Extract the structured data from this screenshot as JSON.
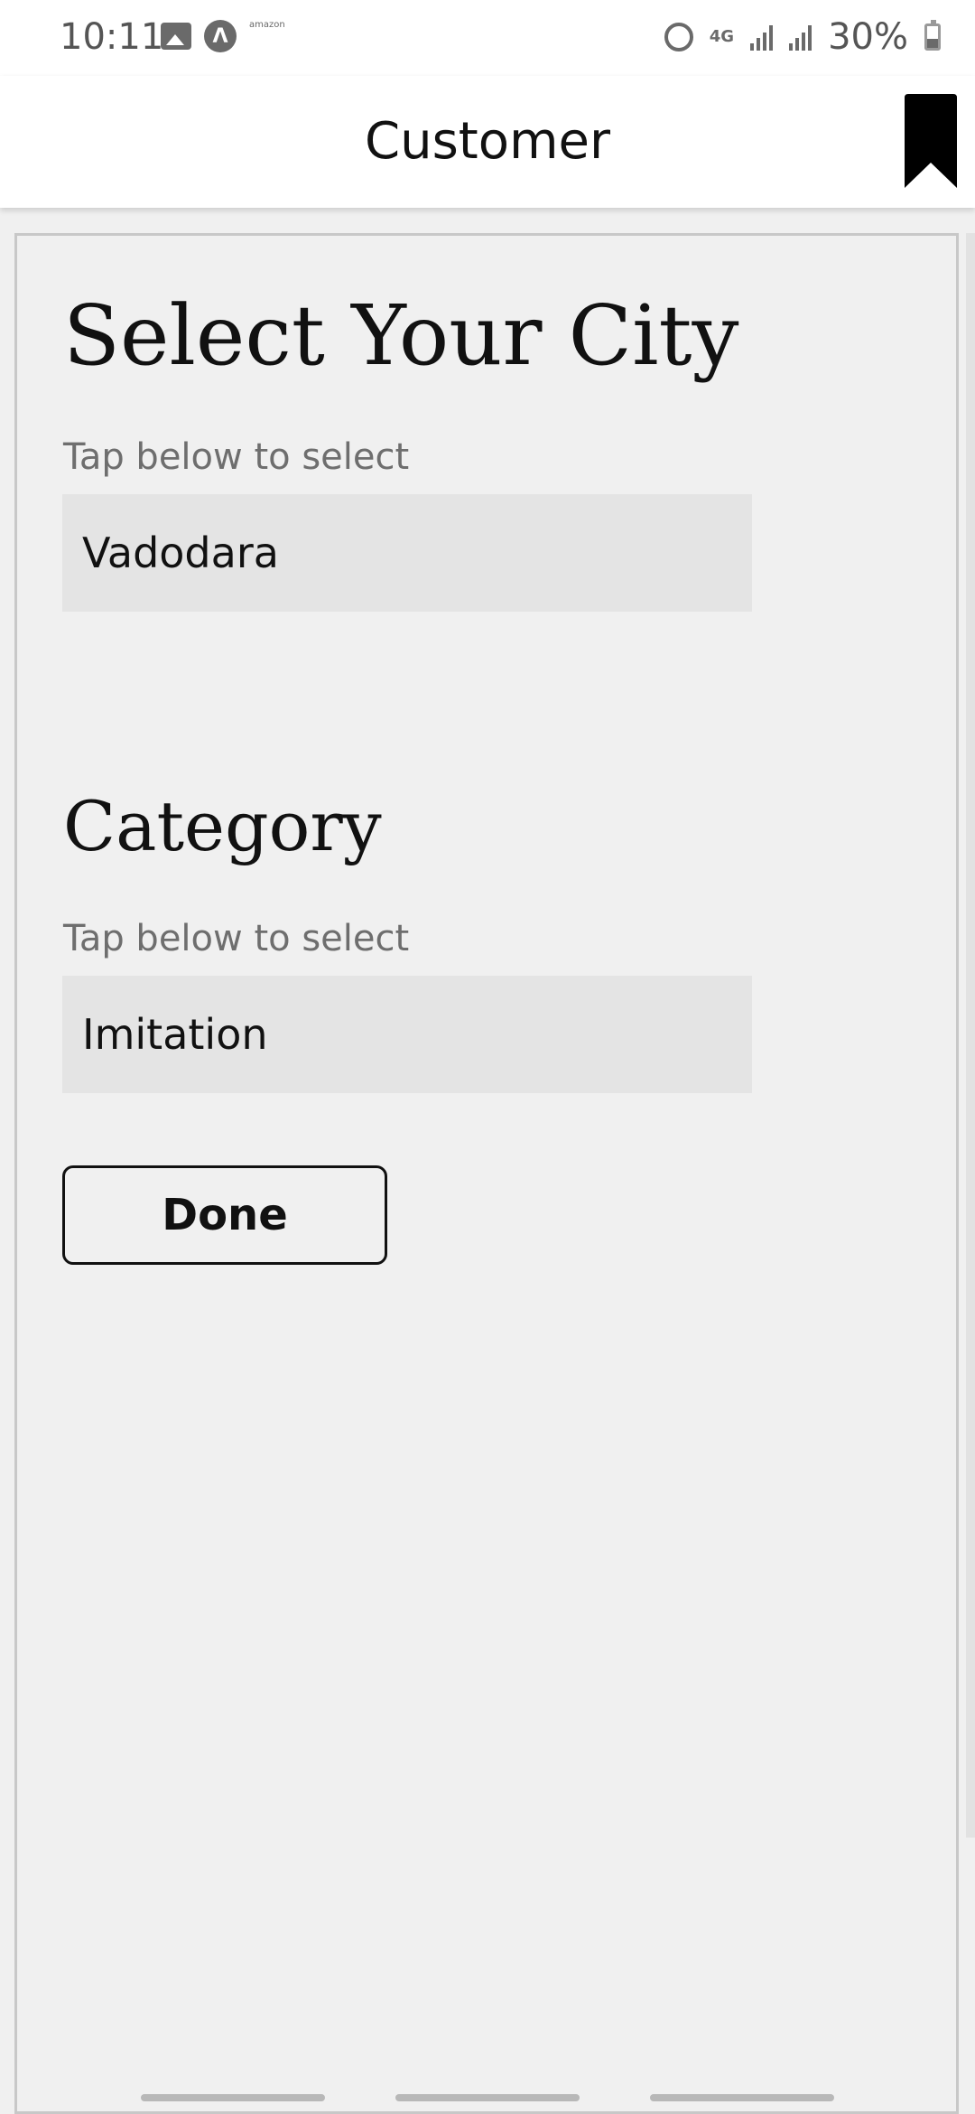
{
  "status_bar": {
    "time": "10:11",
    "amazon_text": "amazon",
    "network": "4G",
    "battery_percent": "30%"
  },
  "appbar": {
    "title": "Customer",
    "bookmark_icon": "bookmark-icon"
  },
  "city_section": {
    "heading": "Select Your City",
    "hint": "Tap below to select",
    "selected_value": "Vadodara"
  },
  "category_section": {
    "heading": "Category",
    "hint": "Tap below to select",
    "selected_value": "Imitation"
  },
  "done_label": "Done",
  "colors": {
    "background": "#f0f0f0",
    "appbar": "#ffffff",
    "field_bg": "#e4e4e4",
    "text": "#111111",
    "hint": "#6e6e6e"
  }
}
